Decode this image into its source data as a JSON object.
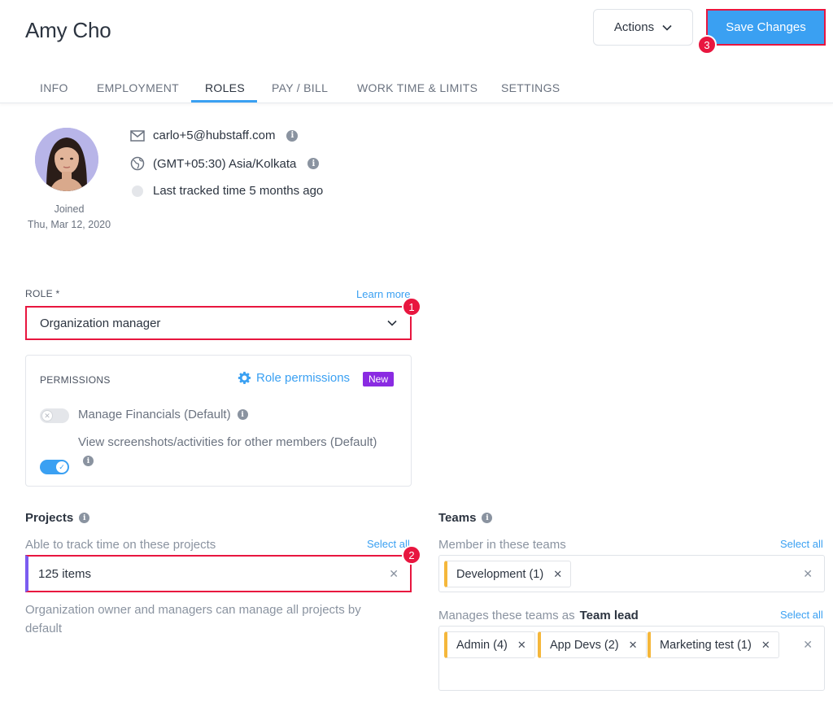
{
  "header": {
    "title": "Amy Cho",
    "actions_label": "Actions",
    "save_label": "Save Changes"
  },
  "tabs": [
    {
      "label": "INFO"
    },
    {
      "label": "EMPLOYMENT"
    },
    {
      "label": "ROLES",
      "active": true
    },
    {
      "label": "PAY / BILL"
    },
    {
      "label": "WORK TIME & LIMITS"
    },
    {
      "label": "SETTINGS"
    }
  ],
  "profile": {
    "joined_label": "Joined",
    "joined_date": "Thu, Mar 12, 2020",
    "email": "carlo+5@hubstaff.com",
    "timezone": "(GMT+05:30) Asia/Kolkata",
    "last_tracked": "Last tracked time 5 months ago"
  },
  "role": {
    "label": "ROLE *",
    "learn_more": "Learn more",
    "value": "Organization manager"
  },
  "permissions": {
    "label": "PERMISSIONS",
    "role_permissions_link": "Role permissions",
    "new_badge": "New",
    "items": [
      {
        "label": "Manage Financials (Default)",
        "enabled": false
      },
      {
        "label": "View screenshots/activities for other members (Default)",
        "enabled": true
      }
    ]
  },
  "projects": {
    "title": "Projects",
    "sub_label": "Able to track time on these projects",
    "select_all": "Select all",
    "value": "125 items",
    "helper": "Organization owner and managers can manage all projects by default"
  },
  "teams": {
    "title": "Teams",
    "member_label": "Member in these teams",
    "member_select_all": "Select all",
    "member_chips": [
      "Development (1)"
    ],
    "lead_label_prefix": "Manages these teams as",
    "lead_label_strong": "Team lead",
    "lead_select_all": "Select all",
    "lead_chips": [
      "Admin (4)",
      "App Devs (2)",
      "Marketing test (1)"
    ]
  },
  "steps": {
    "one": "1",
    "two": "2",
    "three": "3"
  },
  "colors": {
    "accent": "#3aa0f2",
    "highlight": "#e8163f",
    "new_badge": "#8a2be2",
    "chip_accent": "#f5b73b"
  },
  "icons": {
    "dropdown": "chevron-down-icon",
    "email": "mail-icon",
    "timezone": "globe-icon",
    "status": "status-dot-icon",
    "info": "info-icon",
    "settings": "gear-icon",
    "remove": "close-icon"
  }
}
